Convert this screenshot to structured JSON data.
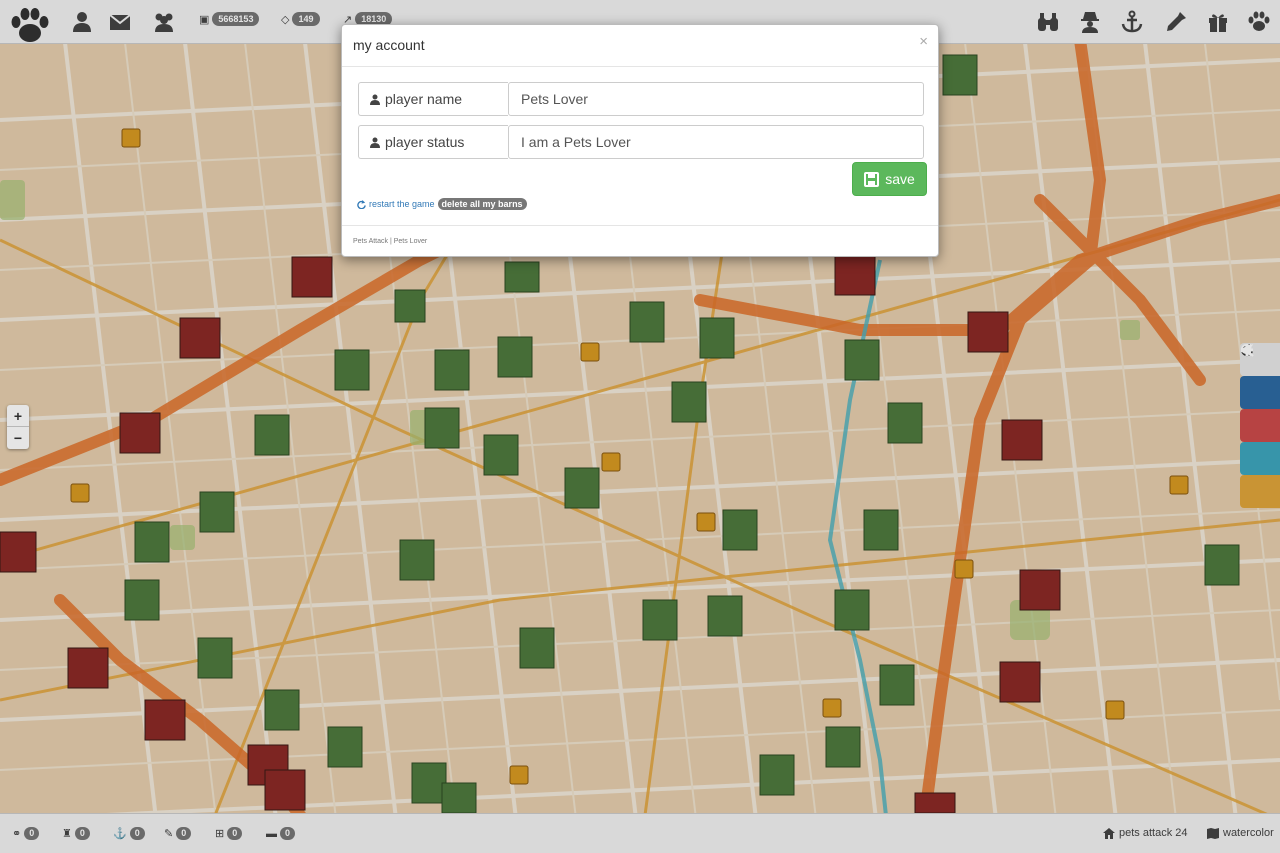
{
  "topbar": {
    "money": "5668153",
    "gems": "149",
    "score": "18130"
  },
  "modal": {
    "title": "my account",
    "close": "×",
    "name_label": "player name",
    "name_value": "Pets Lover",
    "status_label": "player status",
    "status_value": "I am a Pets Lover",
    "save_label": "save",
    "restart_label": "restart the game",
    "delete_label": "delete all my barns",
    "footer": "Pets Attack | Pets Lover"
  },
  "map": {
    "zoom_in": "+",
    "zoom_out": "−"
  },
  "side_buttons": {
    "colors": [
      "#e8e8e8",
      "#2d6aa3",
      "#cc4b4b",
      "#3ea6be",
      "#e0a53a"
    ]
  },
  "bottombar": {
    "counts": [
      "0",
      "0",
      "0",
      "0",
      "0",
      "0"
    ],
    "game_name": "pets attack 24",
    "map_style": "watercolor"
  }
}
